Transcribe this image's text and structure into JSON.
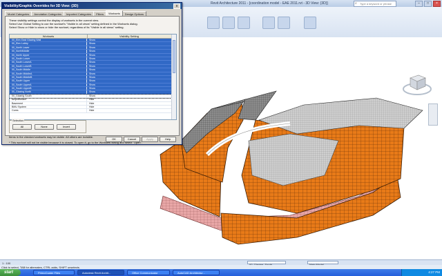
{
  "app": {
    "title": "Revit Architecture 2011 - [coordination model - EAE 2011.rvt - 3D View: {3D}]",
    "search_placeholder": "Type a keyword or phrase"
  },
  "dialog": {
    "title": "Visibility/Graphic Overrides for 3D View: {3D}",
    "close_label": "x",
    "tabs": [
      "Model Categories",
      "Annotation Categories",
      "Imported Categories",
      "Filters",
      "Worksets",
      "Design Options"
    ],
    "active_tab": "Worksets",
    "description": [
      "These visibility settings control the display of worksets in the current view.",
      "Select Use Global Setting to use the workset's \"Visible in all views\" setting defined in the Worksets dialog.",
      "Select Show or Hide to show or hide the workset, regardless of its \"Visible in all views\" setting."
    ],
    "columns": [
      "Worksets",
      "Visibility Setting"
    ],
    "rows": [
      {
        "name": "00_Elev East Glazing Wall",
        "value": "Show",
        "selected": true
      },
      {
        "name": "00_Elev Lobby",
        "value": "Show",
        "selected": true
      },
      {
        "name": "00_North Lower",
        "value": "Show",
        "selected": true
      },
      {
        "name": "00_NorthMiddle",
        "value": "Show",
        "selected": true
      },
      {
        "name": "00_North Upper",
        "value": "Show",
        "selected": true
      },
      {
        "name": "00_South Lower",
        "value": "Show",
        "selected": true
      },
      {
        "name": "00_South LowerA",
        "value": "Show",
        "selected": true
      },
      {
        "name": "00_South LowerB",
        "value": "Show",
        "selected": true
      },
      {
        "name": "00_South Middle",
        "value": "Show",
        "selected": true
      },
      {
        "name": "00_South MiddleA",
        "value": "Show",
        "selected": true
      },
      {
        "name": "00_South MiddleB",
        "value": "Show",
        "selected": true
      },
      {
        "name": "00_South Upper",
        "value": "Show",
        "selected": true
      },
      {
        "name": "00_South UpperA",
        "value": "Show",
        "selected": true
      },
      {
        "name": "00_South UpperB",
        "value": "Show",
        "selected": true
      },
      {
        "name": "00_Glazing North",
        "value": "Show",
        "selected": true
      },
      {
        "name": "00_Glazing South",
        "value": "Show",
        "selected": false,
        "focus": true
      },
      {
        "name": "Amphitheatre",
        "value": "Hide",
        "selected": false
      },
      {
        "name": "Basement",
        "value": "Hide",
        "selected": false
      },
      {
        "name": "BMU System",
        "value": "Hide",
        "selected": false
      },
      {
        "name": "Cores",
        "value": "Hide",
        "selected": false
      }
    ],
    "selection_group_label": "Selection",
    "buttons": {
      "all": "All",
      "none": "None",
      "invert": "Invert"
    },
    "note1": "Items in the checked worksets may be visible. All others are invisible.",
    "note2": "* This workset will not be visible because it is closed. To open it, go to the Worksets dialog and select \"Open\".",
    "footer_buttons": {
      "ok": "OK",
      "cancel": "Cancel",
      "apply": "Apply",
      "help": "Help"
    }
  },
  "status": {
    "scale": "1 : 100",
    "workset": "00_Glazing_South",
    "model": "Main Model",
    "hint": "Click to select, TAB for alternates, CTRL adds, SHIFT unselects."
  },
  "taskbar": {
    "start": "start",
    "tasks": [
      "PrimoCoater Files",
      "Autodesk Revit Archit...",
      "Office Communicator",
      "AutoCAD Architectur..."
    ],
    "clock": "4:27 PM"
  }
}
